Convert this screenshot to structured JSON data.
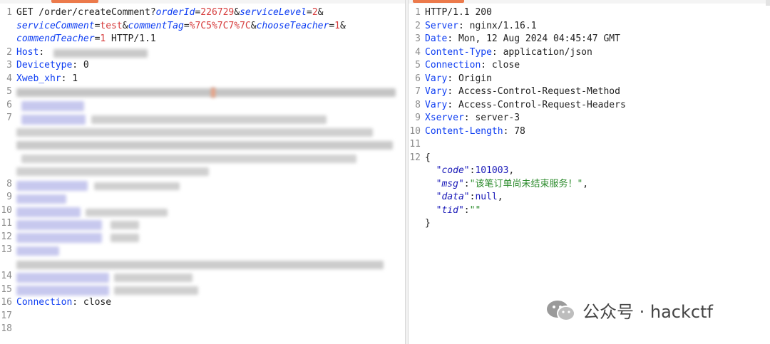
{
  "request": {
    "lines": [
      {
        "n": "1",
        "parts": [
          {
            "t": "GET /order/createComment?",
            "c": "txt"
          },
          {
            "t": "orderId",
            "c": "pname"
          },
          {
            "t": "=",
            "c": "txt"
          },
          {
            "t": "226729",
            "c": "pval"
          },
          {
            "t": "&",
            "c": "txt"
          },
          {
            "t": "serviceLevel",
            "c": "pname"
          },
          {
            "t": "=",
            "c": "txt"
          },
          {
            "t": "2",
            "c": "pval"
          },
          {
            "t": "&",
            "c": "txt"
          }
        ]
      },
      {
        "n": "",
        "parts": [
          {
            "t": "serviceComment",
            "c": "pname"
          },
          {
            "t": "=",
            "c": "txt"
          },
          {
            "t": "test",
            "c": "pval"
          },
          {
            "t": "&",
            "c": "txt"
          },
          {
            "t": "commentTag",
            "c": "pname"
          },
          {
            "t": "=",
            "c": "txt"
          },
          {
            "t": "%7C5%7C7%7C",
            "c": "pval"
          },
          {
            "t": "&",
            "c": "txt"
          },
          {
            "t": "chooseTeacher",
            "c": "pname"
          },
          {
            "t": "=",
            "c": "txt"
          },
          {
            "t": "1",
            "c": "pval"
          },
          {
            "t": "&",
            "c": "txt"
          }
        ]
      },
      {
        "n": "",
        "parts": [
          {
            "t": "commendTeacher",
            "c": "pname"
          },
          {
            "t": "=",
            "c": "txt"
          },
          {
            "t": "1",
            "c": "pval"
          },
          {
            "t": " HTTP/1.1",
            "c": "txt"
          }
        ]
      },
      {
        "n": "2",
        "parts": [
          {
            "t": "Host",
            "c": "key"
          },
          {
            "t": ": ",
            "c": "txt"
          }
        ]
      },
      {
        "n": "3",
        "parts": [
          {
            "t": "Devicetype",
            "c": "key"
          },
          {
            "t": ": 0",
            "c": "txt"
          }
        ]
      },
      {
        "n": "4",
        "parts": [
          {
            "t": "Xweb_xhr",
            "c": "key"
          },
          {
            "t": ": 1",
            "c": "txt"
          }
        ]
      },
      {
        "n": "5",
        "parts": []
      },
      {
        "n": "6",
        "parts": []
      },
      {
        "n": "7",
        "parts": []
      },
      {
        "n": "",
        "parts": []
      },
      {
        "n": "",
        "parts": []
      },
      {
        "n": "",
        "parts": []
      },
      {
        "n": "",
        "parts": []
      },
      {
        "n": "8",
        "parts": []
      },
      {
        "n": "9",
        "parts": []
      },
      {
        "n": "10",
        "parts": []
      },
      {
        "n": "11",
        "parts": []
      },
      {
        "n": "12",
        "parts": []
      },
      {
        "n": "13",
        "parts": []
      },
      {
        "n": "",
        "parts": []
      },
      {
        "n": "14",
        "parts": []
      },
      {
        "n": "15",
        "parts": []
      },
      {
        "n": "16",
        "parts": [
          {
            "t": "Connection",
            "c": "key"
          },
          {
            "t": ": close",
            "c": "txt"
          }
        ]
      },
      {
        "n": "17",
        "parts": []
      },
      {
        "n": "18",
        "parts": []
      }
    ]
  },
  "response": {
    "lines": [
      {
        "n": "1",
        "parts": [
          {
            "t": "HTTP/1.1 200",
            "c": "txt"
          }
        ]
      },
      {
        "n": "2",
        "parts": [
          {
            "t": "Server",
            "c": "key"
          },
          {
            "t": ": nginx/1.16.1",
            "c": "txt"
          }
        ]
      },
      {
        "n": "3",
        "parts": [
          {
            "t": "Date",
            "c": "key"
          },
          {
            "t": ": Mon, 12 Aug 2024 04:45:47 GMT",
            "c": "txt"
          }
        ]
      },
      {
        "n": "4",
        "parts": [
          {
            "t": "Content-Type",
            "c": "key"
          },
          {
            "t": ": application/json",
            "c": "txt"
          }
        ]
      },
      {
        "n": "5",
        "parts": [
          {
            "t": "Connection",
            "c": "key"
          },
          {
            "t": ": close",
            "c": "txt"
          }
        ]
      },
      {
        "n": "6",
        "parts": [
          {
            "t": "Vary",
            "c": "key"
          },
          {
            "t": ": Origin",
            "c": "txt"
          }
        ]
      },
      {
        "n": "7",
        "parts": [
          {
            "t": "Vary",
            "c": "key"
          },
          {
            "t": ": Access-Control-Request-Method",
            "c": "txt"
          }
        ]
      },
      {
        "n": "8",
        "parts": [
          {
            "t": "Vary",
            "c": "key"
          },
          {
            "t": ": Access-Control-Request-Headers",
            "c": "txt"
          }
        ]
      },
      {
        "n": "9",
        "parts": [
          {
            "t": "Xserver",
            "c": "key"
          },
          {
            "t": ": server-3",
            "c": "txt"
          }
        ]
      },
      {
        "n": "10",
        "parts": [
          {
            "t": "Content-Length",
            "c": "key"
          },
          {
            "t": ": 78",
            "c": "txt"
          }
        ]
      },
      {
        "n": "11",
        "parts": []
      },
      {
        "n": "12",
        "parts": [
          {
            "t": "{",
            "c": "txt"
          }
        ]
      },
      {
        "n": "",
        "parts": [
          {
            "t": "  \"code\"",
            "c": "jkey"
          },
          {
            "t": ":",
            "c": "txt"
          },
          {
            "t": "101003",
            "c": "jnum"
          },
          {
            "t": ",",
            "c": "txt"
          }
        ]
      },
      {
        "n": "",
        "parts": [
          {
            "t": "  \"msg\"",
            "c": "jkey"
          },
          {
            "t": ":",
            "c": "txt"
          },
          {
            "t": "\"该笔订单尚未结束服务！\"",
            "c": "jstr"
          },
          {
            "t": ",",
            "c": "txt"
          }
        ]
      },
      {
        "n": "",
        "parts": [
          {
            "t": "  \"data\"",
            "c": "jkey"
          },
          {
            "t": ":",
            "c": "txt"
          },
          {
            "t": "null",
            "c": "jnum"
          },
          {
            "t": ",",
            "c": "txt"
          }
        ]
      },
      {
        "n": "",
        "parts": [
          {
            "t": "  \"tid\"",
            "c": "jkey"
          },
          {
            "t": ":",
            "c": "txt"
          },
          {
            "t": "\"\"",
            "c": "jstr"
          }
        ]
      },
      {
        "n": "",
        "parts": [
          {
            "t": "}",
            "c": "txt"
          }
        ]
      }
    ]
  },
  "watermark": {
    "text": "公众号 · hackctf"
  },
  "icons": {
    "watermark": "wechat-icon"
  },
  "colors": {
    "tab_accent": "#ec7a4b",
    "key": "#0d3df2",
    "param_value": "#d63b3b",
    "json_string": "#2a8a2a"
  }
}
